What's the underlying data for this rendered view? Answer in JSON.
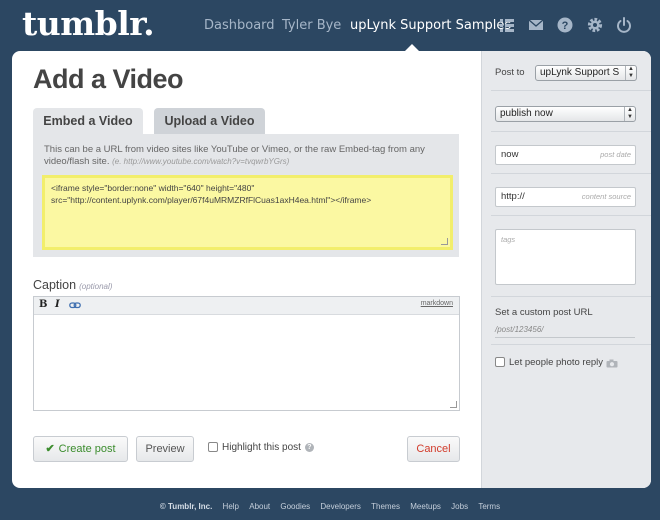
{
  "logo": "tumblr.",
  "nav": {
    "dashboard": "Dashboard",
    "user": "Tyler Bye",
    "blog": "upLynk Support Samples",
    "icons": [
      "list-icon",
      "mail-icon",
      "help-icon",
      "gear-icon",
      "power-icon"
    ]
  },
  "page": {
    "title": "Add a Video",
    "tabs": [
      "Embed a Video",
      "Upload a Video"
    ],
    "hint": "This can be a URL from video sites like YouTube or Vimeo, or the raw Embed-tag from any video/flash site.",
    "hint_example": "(e. http://www.youtube.com/watch?v=tvqwrbYGrs)",
    "embed_value": "<iframe style=\"border:none\" width=\"640\" height=\"480\" src=\"http://content.uplynk.com/player/67f4uMRMZRfFlCuas1axH4ea.html\"></iframe>",
    "caption_label": "Caption",
    "caption_optional": "(optional)",
    "toolbar": {
      "bold": "B",
      "italic": "I",
      "markdown": "markdown"
    }
  },
  "actions": {
    "create": "Create post",
    "preview": "Preview",
    "highlight": "Highlight this post",
    "cancel": "Cancel"
  },
  "sidebar": {
    "post_to_label": "Post to",
    "post_to_value": "upLynk Support S",
    "publish_value": "publish now",
    "date_value": "now",
    "date_placeholder": "post date",
    "source_value": "http://",
    "source_placeholder": "content source",
    "tags_placeholder": "tags",
    "custom_url_label": "Set a custom post URL",
    "custom_url_placeholder": "/post/123456/",
    "photo_reply_label": "Let people photo reply"
  },
  "footer": {
    "copyright": "© Tumblr, Inc.",
    "links": [
      "Help",
      "About",
      "Goodies",
      "Developers",
      "Themes",
      "Meetups",
      "Jobs",
      "Terms"
    ]
  },
  "colors": {
    "background": "#2c4762",
    "create": "#3b8c2d",
    "cancel": "#d23c2c",
    "embed_bg": "#fbf8a2"
  }
}
